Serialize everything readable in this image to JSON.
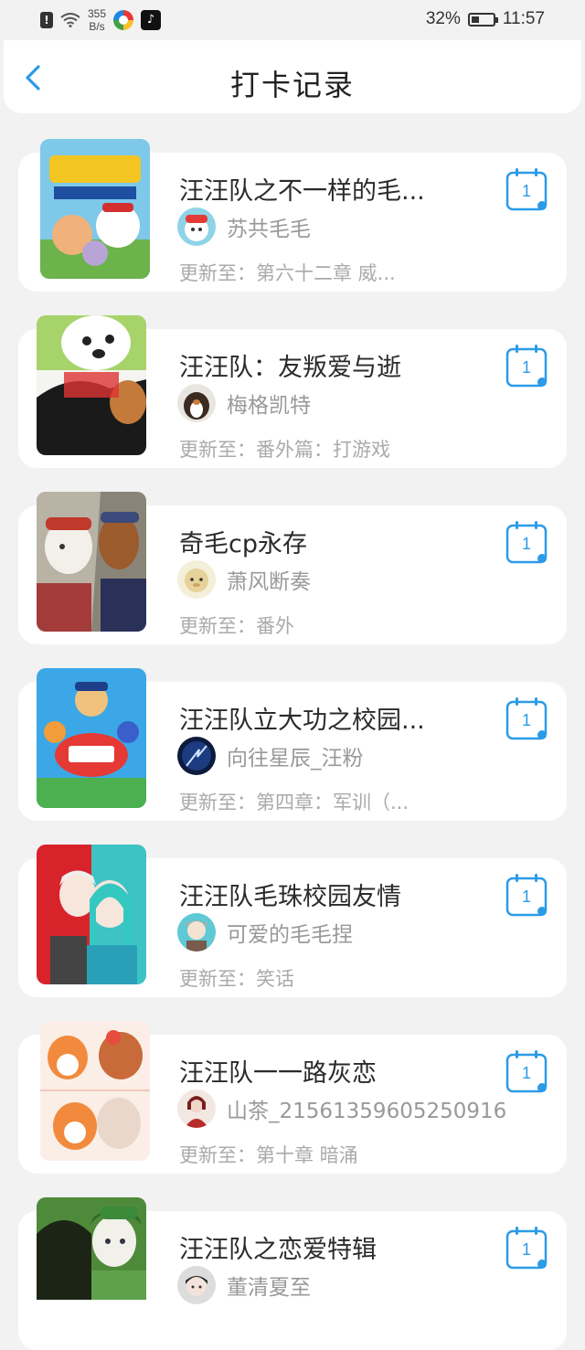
{
  "status_bar": {
    "speed_value": "355",
    "speed_unit": "B/s",
    "battery": "32%",
    "time": "11:57",
    "icons": [
      "alert-icon",
      "wifi-icon",
      "app-icon",
      "app-icon",
      "battery-icon"
    ]
  },
  "header": {
    "title": "打卡记录",
    "back_icon": "chevron-left-icon"
  },
  "colors": {
    "accent": "#2b9be8",
    "background": "#f2f2f2",
    "card": "#ffffff",
    "muted_text": "#999999"
  },
  "records": [
    {
      "title": "汪汪队之不一样的毛...",
      "author": "苏共毛毛",
      "update": "更新至：第六十二章  威...",
      "checkins": "1"
    },
    {
      "title": "汪汪队：友叛爱与逝",
      "author": "梅格凯特",
      "update": "更新至：番外篇：打游戏",
      "checkins": "1"
    },
    {
      "title": "奇毛cp永存",
      "author": "萧风断奏",
      "update": "更新至：番外",
      "checkins": "1"
    },
    {
      "title": "汪汪队立大功之校园...",
      "author": "向往星辰_汪粉",
      "update": "更新至：第四章：军训（...",
      "checkins": "1"
    },
    {
      "title": "汪汪队毛珠校园友情",
      "author": "可爱的毛毛捏",
      "update": "更新至：笑话",
      "checkins": "1"
    },
    {
      "title": "汪汪队一一路灰恋",
      "author": "山茶_21561359605250916",
      "update": "更新至：第十章   暗涌",
      "checkins": "1"
    },
    {
      "title": "汪汪队之恋爱特辑",
      "author": "董清夏至",
      "update": "",
      "checkins": "1"
    }
  ]
}
